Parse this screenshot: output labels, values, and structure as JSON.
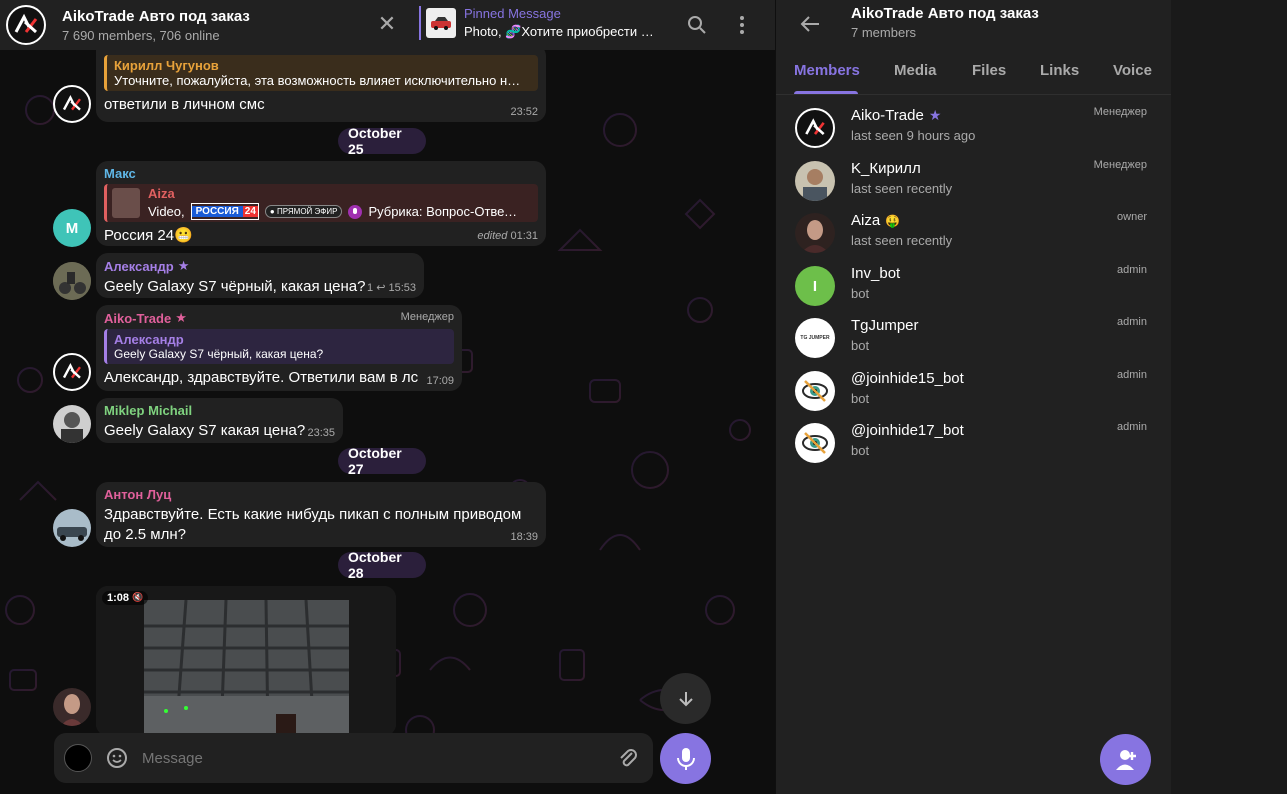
{
  "chat": {
    "title": "AikoTrade Авто под заказ",
    "subtitle": "7 690 members, 706 online",
    "pinned": {
      "title": "Pinned Message",
      "text": "Photo, 🧬Хотите приобрести …"
    }
  },
  "messages": {
    "m1": {
      "quote_name": "Кирилл Чугунов",
      "quote_text": "Уточните, пожалуйста, эта возможность влияет исключительно н…",
      "text": "ответили в личном смс",
      "time": "23:52"
    },
    "date1": "October 25",
    "m2": {
      "sender": "Макс",
      "avatar_letter": "M",
      "quote_name": "Aiza",
      "quote_text_a": "Video,",
      "channel_badge": "РОССИЯ",
      "channel_num": "24",
      "live_badge": "● ПРЯМОЙ ЭФИР",
      "quote_text_b": "Рубрика: Вопрос-Ответ…",
      "text": "Россия 24😬",
      "edited": "edited",
      "time": "01:31"
    },
    "m3": {
      "sender": "Александр",
      "text": "Geely Galaxy S7 чёрный, какая цена?",
      "replies": "1",
      "time": "15:53"
    },
    "m4": {
      "sender": "Aiko-Trade",
      "role": "Менеджер",
      "quote_name": "Александр",
      "quote_text": "Geely Galaxy S7 чёрный, какая цена?",
      "text": "Александр, здравствуйте. Ответили вам в лс",
      "time": "17:09"
    },
    "m5": {
      "sender": "Miklep Michail",
      "text": "Geely Galaxy S7  какая цена?",
      "time": "23:35"
    },
    "date2": "October 27",
    "m6": {
      "sender": "Антон Луц",
      "text_line1": "Здравствуйте. Есть какие нибудь пикап с полным приводом",
      "text_line2": "до 2.5 млн?",
      "time": "18:39"
    },
    "date3": "October 28",
    "m7": {
      "duration": "1:08",
      "mute_icon": "🔇"
    }
  },
  "composer": {
    "placeholder": "Message"
  },
  "panel": {
    "title": "AikoTrade Авто под заказ",
    "subtitle": "7 members",
    "tabs": [
      "Members",
      "Media",
      "Files",
      "Links",
      "Voice"
    ],
    "members": [
      {
        "name": "Aiko-Trade",
        "status": "last seen 9 hours ago",
        "role": "Менеджер"
      },
      {
        "name": "K_Кирилл",
        "status": "last seen recently",
        "role": "Менеджер"
      },
      {
        "name": "Aiza",
        "status": "last seen recently",
        "role": "owner"
      },
      {
        "name": "Inv_bot",
        "status": "bot",
        "role": "admin",
        "avatar_letter": "I"
      },
      {
        "name": "TgJumper",
        "status": "bot",
        "role": "admin",
        "avatar_text": "TG JUMPER"
      },
      {
        "name": "@joinhide15_bot",
        "status": "bot",
        "role": "admin"
      },
      {
        "name": "@joinhide17_bot",
        "status": "bot",
        "role": "admin"
      }
    ]
  },
  "colors": {
    "accent": "#8774e1",
    "sender_max": "#5fb6e6",
    "sender_alexandr": "#a57fe6",
    "sender_aiko": "#e0609b",
    "sender_miklep": "#7fd27f",
    "sender_anton": "#e0609b",
    "quote_kirill": "#e8a23a",
    "quote_aiza": "#e06060",
    "inv_bot_avatar": "#6dbf4a",
    "max_avatar": "#3fc4b8"
  }
}
